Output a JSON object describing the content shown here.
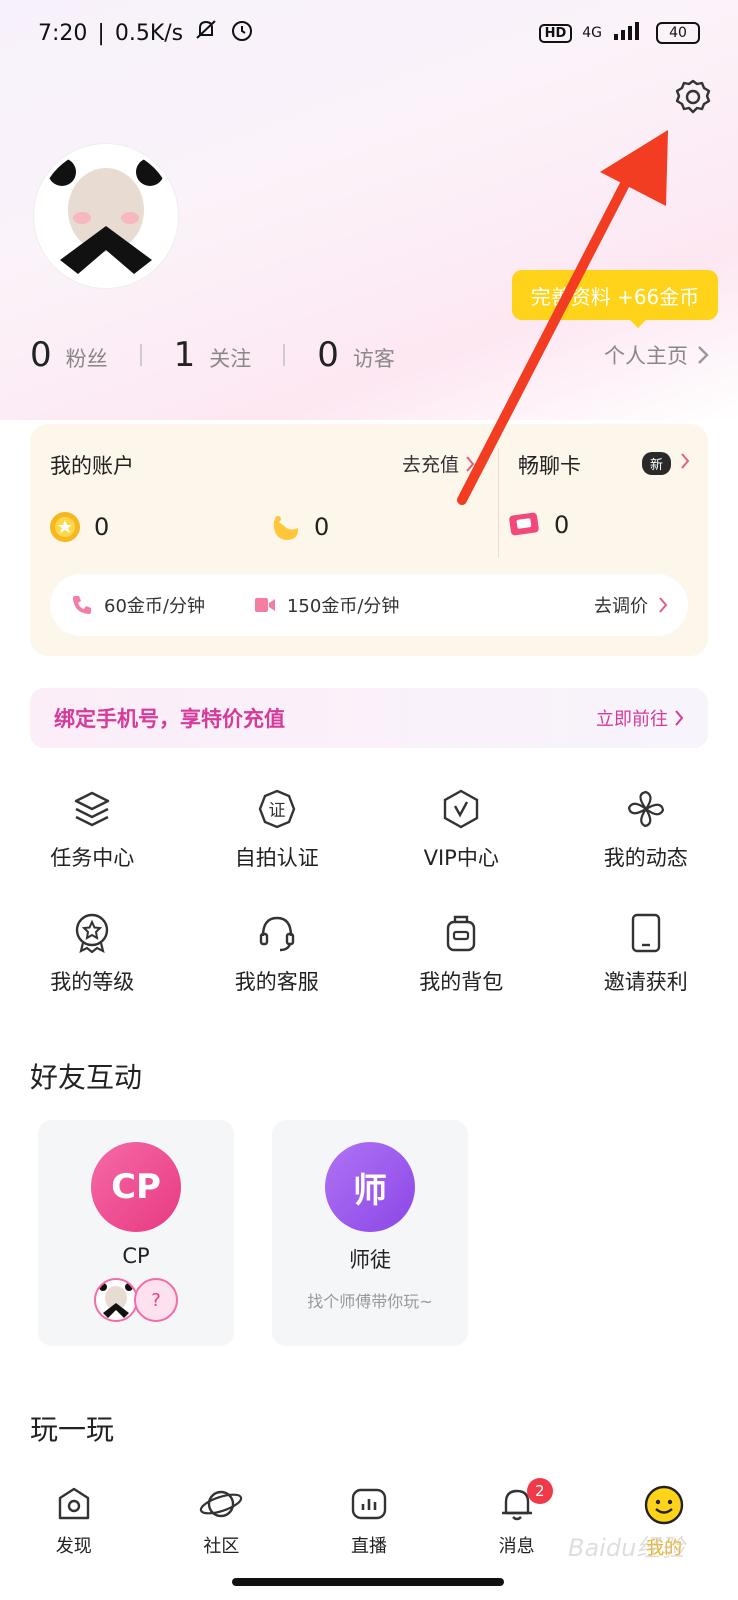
{
  "status_bar": {
    "time": "7:20",
    "speed": "0.5K/s",
    "network": "4G",
    "hd": "HD",
    "battery": "40"
  },
  "profile": {
    "complete_tip": "完善资料 +66金币",
    "stats": [
      {
        "num": "0",
        "label": "粉丝"
      },
      {
        "num": "1",
        "label": "关注"
      },
      {
        "num": "0",
        "label": "访客"
      }
    ],
    "home_link": "个人主页"
  },
  "account": {
    "title": "我的账户",
    "recharge": "去充值",
    "chat_card": "畅聊卡",
    "new_badge": "新",
    "coin_value": "0",
    "bean_value": "0",
    "card_value": "0",
    "voice_price": "60金币/分钟",
    "video_price": "150金币/分钟",
    "adjust_price": "去调价"
  },
  "bind_banner": {
    "text": "绑定手机号，享特价充值",
    "action": "立即前往"
  },
  "features": [
    {
      "label": "任务中心",
      "icon": "layers-icon"
    },
    {
      "label": "自拍认证",
      "icon": "certificate-icon"
    },
    {
      "label": "VIP中心",
      "icon": "vip-icon"
    },
    {
      "label": "我的动态",
      "icon": "pinwheel-icon"
    },
    {
      "label": "我的等级",
      "icon": "medal-icon"
    },
    {
      "label": "我的客服",
      "icon": "headset-icon"
    },
    {
      "label": "我的背包",
      "icon": "backpack-icon"
    },
    {
      "label": "邀请获利",
      "icon": "tablet-icon"
    }
  ],
  "friends": {
    "title": "好友互动",
    "cp_badge": "CP",
    "cp_name": "CP",
    "cp_unknown": "?",
    "mentor_badge": "师",
    "mentor_name": "师徒",
    "mentor_sub": "找个师傅带你玩~"
  },
  "play_title": "玩一玩",
  "bottom_nav": [
    {
      "label": "发现",
      "icon": "discover-icon"
    },
    {
      "label": "社区",
      "icon": "planet-icon"
    },
    {
      "label": "直播",
      "icon": "live-icon"
    },
    {
      "label": "消息",
      "icon": "bell-icon",
      "badge": "2"
    },
    {
      "label": "我的",
      "icon": "smiley-icon"
    }
  ],
  "watermark": "Baidu经验",
  "colors": {
    "accent_yellow": "#ffd31a",
    "pink": "#d63a9a",
    "cp_pink": "#e83a81",
    "mentor_purple": "#8b47e6",
    "arrow_red": "#f23d22"
  }
}
